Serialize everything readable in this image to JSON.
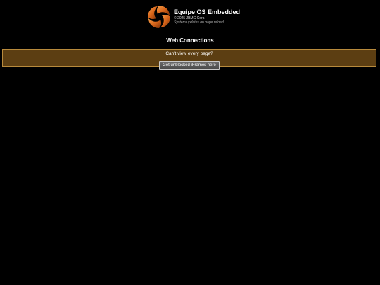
{
  "brand": {
    "logo_icon": "orange-swirl-logo-icon",
    "title": "Equipe OS Embedded",
    "copyright": "© 2025 JBMC Corp.",
    "note": "System updates on page reload"
  },
  "section": {
    "title": "Web Connections"
  },
  "notice": {
    "text": "Can't view every page?",
    "button_label": "Get unblocked iFrames here"
  },
  "colors": {
    "background": "#000000",
    "notice_fill": "#5c3e12",
    "notice_border": "#b88a3c",
    "logo_orange": "#e0701e"
  }
}
